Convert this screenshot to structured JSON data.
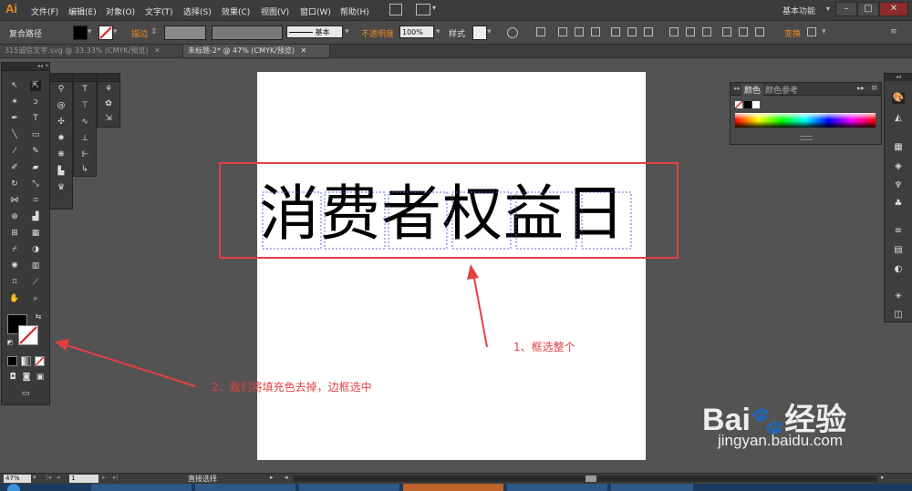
{
  "app": {
    "logo": "Ai",
    "workspace": "基本功能"
  },
  "menu": [
    "文件(F)",
    "编辑(E)",
    "对象(O)",
    "文字(T)",
    "选择(S)",
    "效果(C)",
    "视图(V)",
    "窗口(W)",
    "帮助(H)"
  ],
  "controlbar": {
    "object_type": "复合路径",
    "stroke_label": "描边",
    "stroke_style": "基本",
    "opacity_label": "不透明度",
    "opacity_value": "100%",
    "style_label": "样式",
    "transform_label": "变换"
  },
  "tabs": [
    {
      "label": "315诚信文字.svg @ 33.33% (CMYK/预览)",
      "active": false
    },
    {
      "label": "未标题-2* @ 47% (CMYK/预览)",
      "active": true
    }
  ],
  "canvas": {
    "headline": "消费者权益日",
    "annotation_1": "1、框选整个",
    "annotation_2": "2、我们将填充色去掉，边框选中"
  },
  "panels": {
    "color_tab": "颜色",
    "color_ref_tab": "颜色参考"
  },
  "status": {
    "zoom": "47%",
    "page": "1",
    "tool": "直接选择"
  },
  "watermark": {
    "brand": "Bai",
    "brand2": "经验",
    "url": "jingyan.baidu.com"
  },
  "colors": {
    "accent": "#f08a24",
    "annotation": "#e24142",
    "selection": "#4a5bd8"
  }
}
